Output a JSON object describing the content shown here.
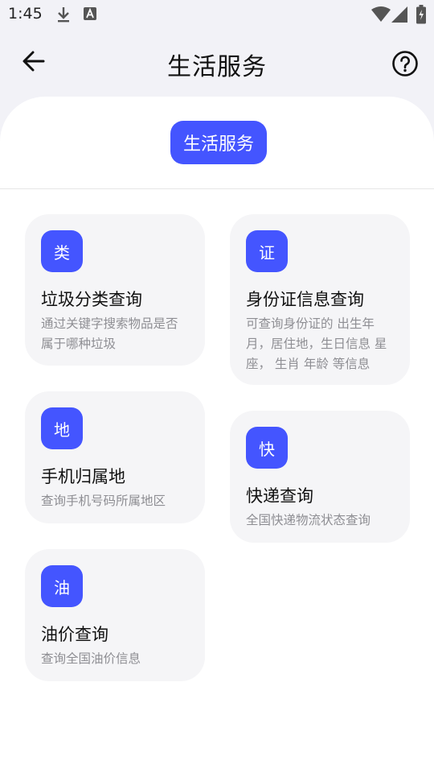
{
  "status_bar": {
    "time": "1:45"
  },
  "header": {
    "title": "生活服务"
  },
  "tabs": [
    {
      "label": "生活服务"
    }
  ],
  "cards": [
    {
      "badge": "类",
      "title": "垃圾分类查询",
      "desc": "通过关键字搜索物品是否属于哪种垃圾"
    },
    {
      "badge": "证",
      "title": "身份证信息查询",
      "desc": "可查询身份证的 出生年月，居住地，生日信息 星座， 生肖 年龄 等信息"
    },
    {
      "badge": "地",
      "title": "手机归属地",
      "desc": "查询手机号码所属地区"
    },
    {
      "badge": "快",
      "title": "快递查询",
      "desc": "全国快递物流状态查询"
    },
    {
      "badge": "油",
      "title": "油价查询",
      "desc": "查询全国油价信息"
    }
  ],
  "colors": {
    "accent": "#4455ff",
    "card_bg": "#f5f5f7",
    "header_bg": "#f2f2f7"
  }
}
